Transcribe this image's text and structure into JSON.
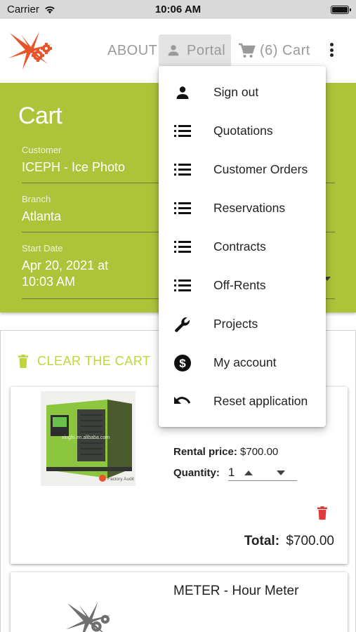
{
  "status_bar": {
    "carrier": "Carrier",
    "time": "10:06 AM"
  },
  "header": {
    "nav_about": "ABOUT",
    "nav_portal": "Portal",
    "nav_cart": "(6) Cart"
  },
  "cart": {
    "title": "Cart",
    "customer_label": "Customer",
    "customer_value": "ICEPH - Ice Photo",
    "branch_label": "Branch",
    "branch_value": "Atlanta",
    "start_label": "Start Date",
    "start_value_line1": "Apr 20, 2021 at",
    "start_value_line2": "10:03 AM",
    "clear_label": "CLEAR THE CART"
  },
  "items": [
    {
      "image_watermark": "xingfo.en.alibaba.com",
      "image_badge": "Factory Audit",
      "rental_label": "Rental price:",
      "rental_value": "$700.00",
      "quantity_label": "Quantity:",
      "quantity_value": "1",
      "total_label": "Total:",
      "total_value": "$700.00"
    },
    {
      "name": "METER - Hour Meter"
    }
  ],
  "menu": {
    "items": [
      {
        "label": "Sign out",
        "icon": "person-icon"
      },
      {
        "label": "Quotations",
        "icon": "list-icon"
      },
      {
        "label": "Customer Orders",
        "icon": "list-icon"
      },
      {
        "label": "Reservations",
        "icon": "list-icon"
      },
      {
        "label": "Contracts",
        "icon": "list-icon"
      },
      {
        "label": "Off-Rents",
        "icon": "list-icon"
      },
      {
        "label": "Projects",
        "icon": "wrench-icon"
      },
      {
        "label": "My account",
        "icon": "dollar-circle-icon"
      },
      {
        "label": "Reset application",
        "icon": "undo-icon"
      }
    ]
  },
  "colors": {
    "accent_green": "#adc43a",
    "clear_text": "#c2d43d",
    "logo_orange": "#e8542a",
    "trash_red": "#e03a3a"
  }
}
